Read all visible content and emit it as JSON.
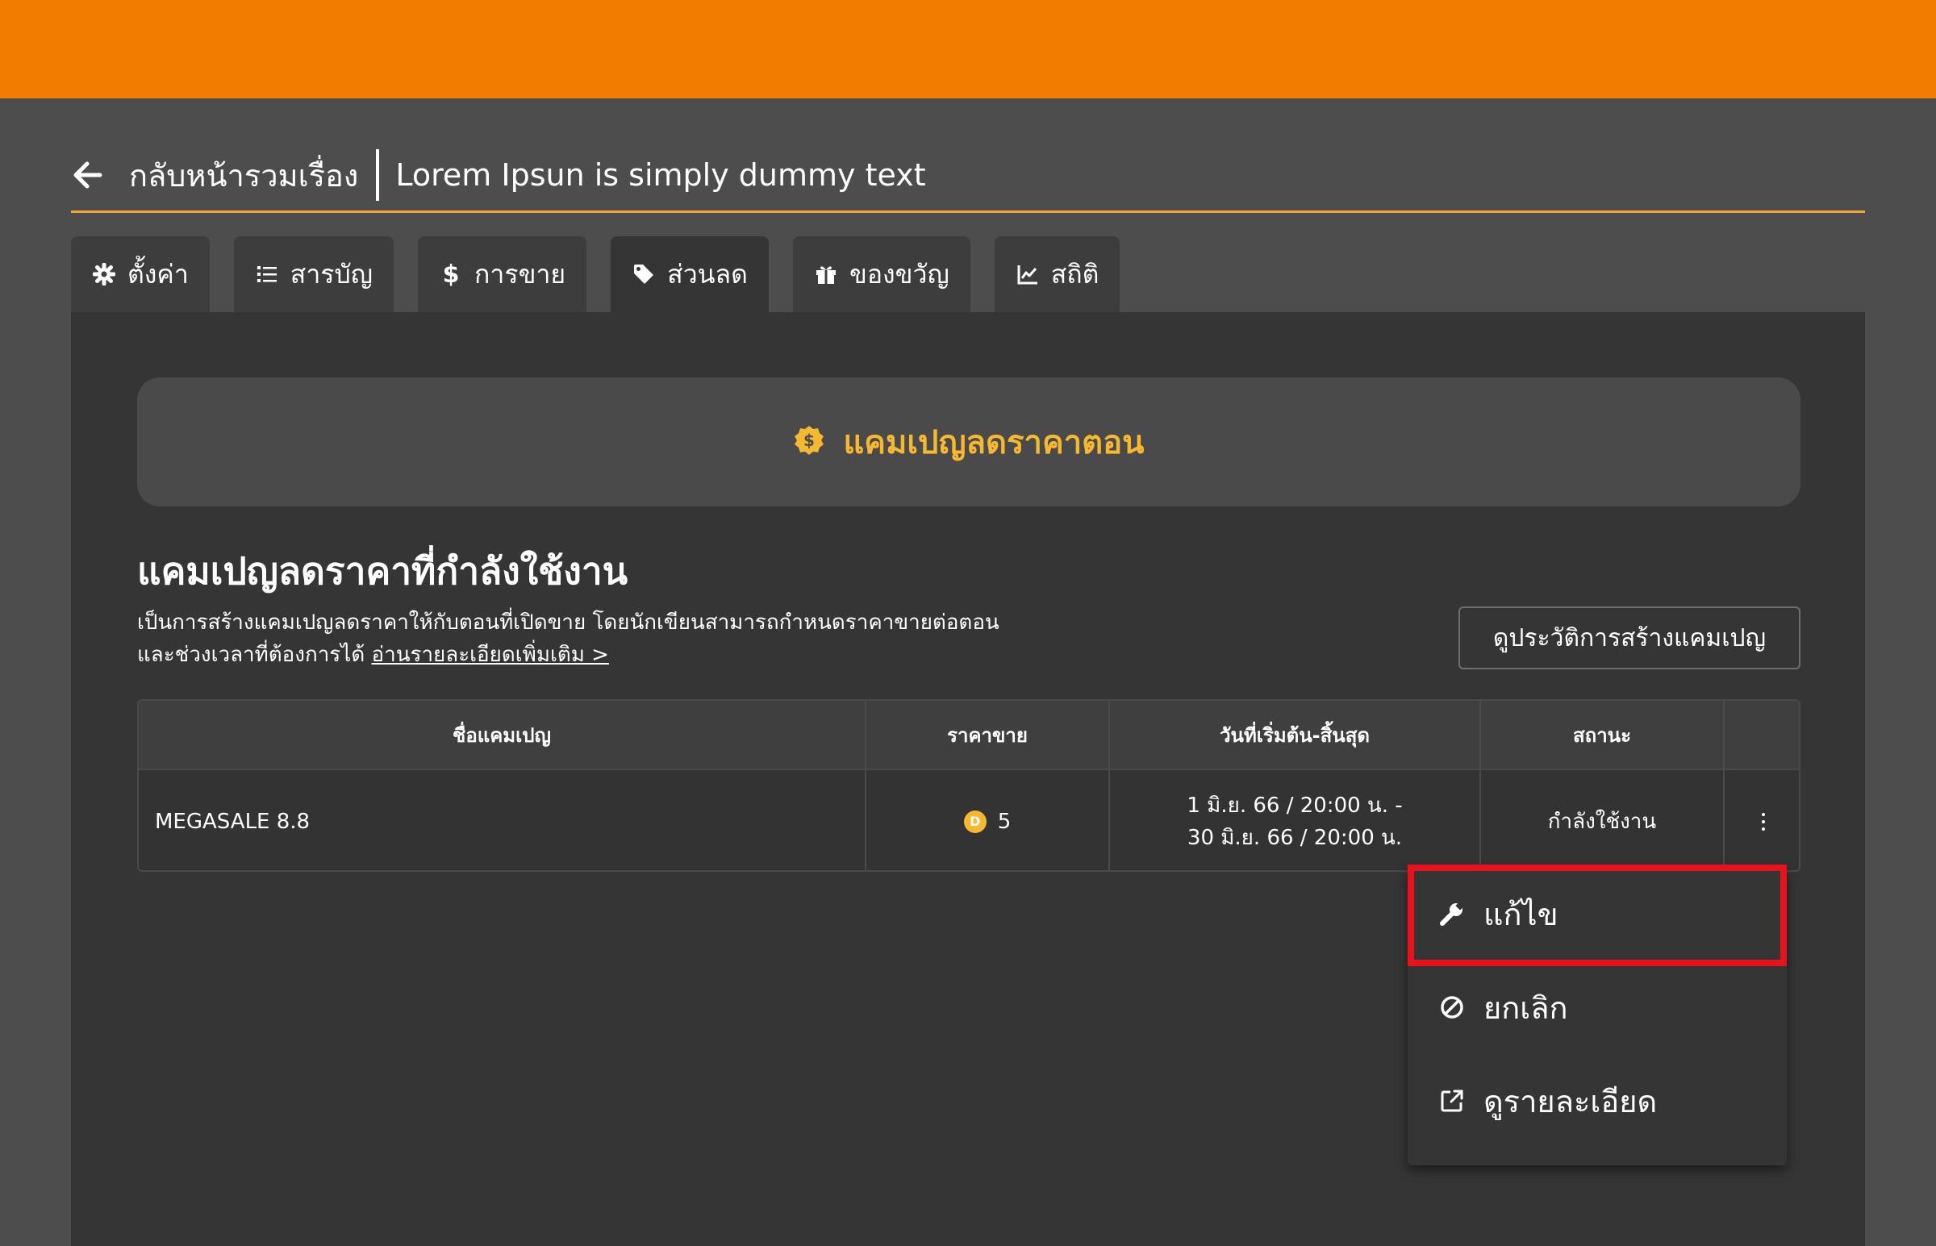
{
  "colors": {
    "topbar": "#f27c00",
    "accent": "#f5b830",
    "highlight": "#e8121d"
  },
  "header": {
    "back_label": "กลับหน้ารวมเรื่อง",
    "title": "Lorem Ipsun is simply dummy text"
  },
  "tabs": [
    {
      "label": "ตั้งค่า",
      "icon": "gear-icon"
    },
    {
      "label": "สารบัญ",
      "icon": "list-icon"
    },
    {
      "label": "การขาย",
      "icon": "dollar-icon"
    },
    {
      "label": "ส่วนลด",
      "icon": "tag-icon",
      "active": true
    },
    {
      "label": "ของขวัญ",
      "icon": "gift-icon"
    },
    {
      "label": "สถิติ",
      "icon": "chart-line-icon"
    }
  ],
  "banner": {
    "label": "แคมเปญลดราคาตอน",
    "icon": "discount-badge-icon"
  },
  "section": {
    "title": "แคมเปญลดราคาที่กำลังใช้งาน",
    "desc_line1": "เป็นการสร้างแคมเปญลดราคาให้กับตอนที่เปิดขาย โดยนักเขียนสามารถกำหนดราคาขายต่อตอน",
    "desc_line2": "และช่วงเวลาที่ต้องการได้",
    "read_more": "อ่านรายละเอียดเพิ่มเติม >",
    "history_button": "ดูประวัติการสร้างแคมเปญ"
  },
  "table": {
    "columns": [
      "ชื่อแคมเปญ",
      "ราคาขาย",
      "วันที่เริ่มต้น-สิ้นสุด",
      "สถานะ"
    ],
    "rows": [
      {
        "name": "MEGASALE 8.8",
        "coin_symbol": "D",
        "price": "5",
        "start": "1 มิ.ย. 66 / 20:00 น. -",
        "end": "30 มิ.ย. 66 / 20:00 น.",
        "status": "กำลังใช้งาน"
      }
    ]
  },
  "menu": {
    "edit": "แก้ไข",
    "cancel": "ยกเลิก",
    "detail": "ดูรายละเอียด"
  }
}
